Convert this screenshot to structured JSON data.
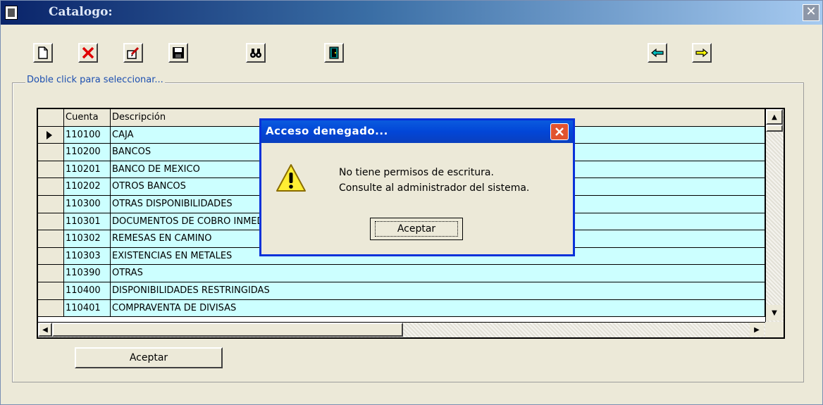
{
  "window": {
    "title": "Catalogo:"
  },
  "toolbar": {
    "buttons": [
      {
        "name": "new-document-icon"
      },
      {
        "name": "delete-icon"
      },
      {
        "name": "edit-icon"
      },
      {
        "name": "save-icon"
      },
      {
        "name": "binoculars-icon"
      },
      {
        "name": "exit-door-icon"
      },
      {
        "name": "arrow-left-icon"
      },
      {
        "name": "arrow-right-icon"
      }
    ]
  },
  "group": {
    "label": "Doble click para seleccionar..."
  },
  "grid": {
    "columns": [
      "Cuenta",
      "Descripción"
    ],
    "rows": [
      {
        "cuenta": "110100",
        "descripcion": "CAJA"
      },
      {
        "cuenta": "110200",
        "descripcion": "BANCOS"
      },
      {
        "cuenta": "110201",
        "descripcion": "BANCO DE MEXICO"
      },
      {
        "cuenta": "110202",
        "descripcion": "OTROS BANCOS"
      },
      {
        "cuenta": "110300",
        "descripcion": "OTRAS DISPONIBILIDADES"
      },
      {
        "cuenta": "110301",
        "descripcion": "DOCUMENTOS DE COBRO INMEDIATO"
      },
      {
        "cuenta": "110302",
        "descripcion": "REMESAS EN CAMINO"
      },
      {
        "cuenta": "110303",
        "descripcion": "EXISTENCIAS EN METALES"
      },
      {
        "cuenta": "110390",
        "descripcion": "OTRAS"
      },
      {
        "cuenta": "110400",
        "descripcion": "DISPONIBILIDADES RESTRINGIDAS"
      },
      {
        "cuenta": "110401",
        "descripcion": "COMPRAVENTA DE DIVISAS"
      }
    ],
    "selected_row": 0
  },
  "footer": {
    "accept_label": "Aceptar"
  },
  "dialog": {
    "title": "Acceso denegado...",
    "line1": "No tiene permisos de escritura.",
    "line2": "Consulte al administrador del sistema.",
    "button_label": "Aceptar"
  },
  "colors": {
    "grid_cell": "#ccffff",
    "dialog_title": "#0246d7",
    "window_bg": "#ece9d8"
  }
}
